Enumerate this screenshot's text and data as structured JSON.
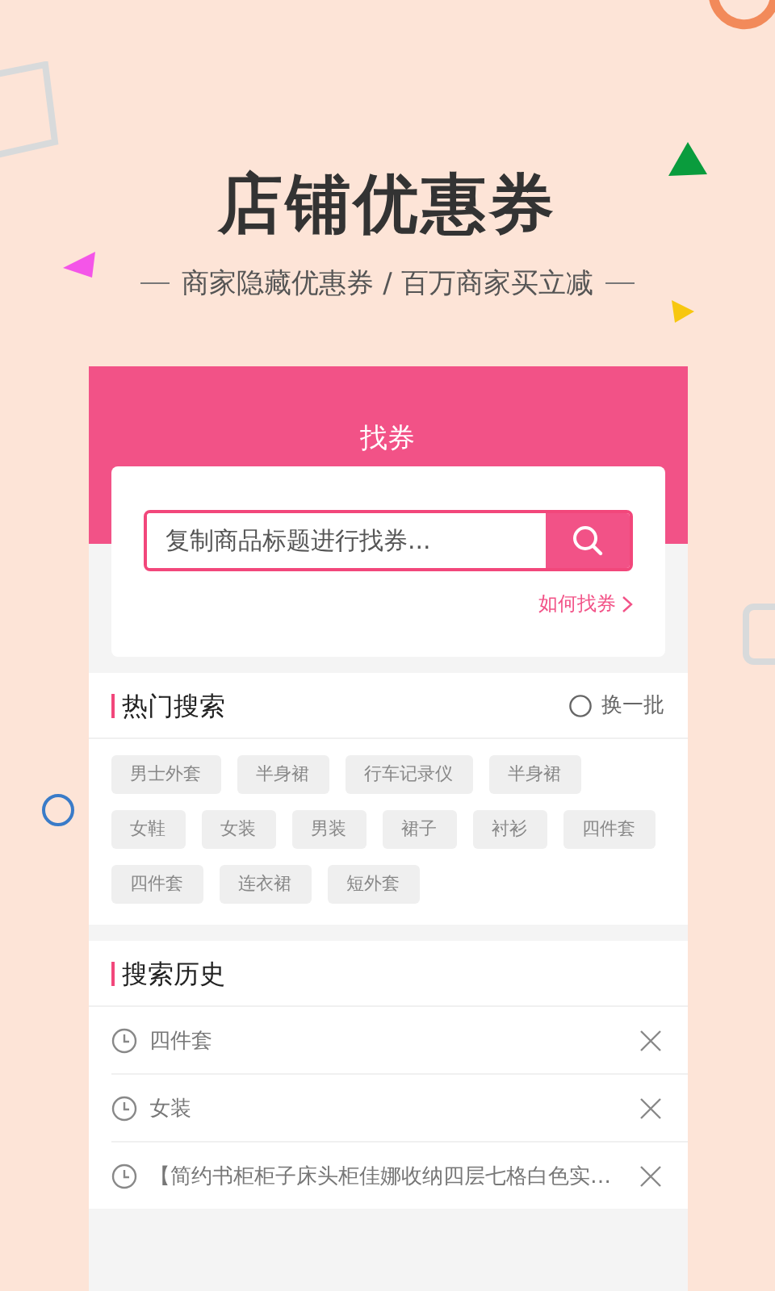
{
  "hero": {
    "title": "店铺优惠券",
    "subtitle": "商家隐藏优惠券 / 百万商家买立减"
  },
  "screen": {
    "title": "找券",
    "search": {
      "placeholder": "复制商品标题进行找券..."
    },
    "help_link": "如何找券",
    "hot_search": {
      "title": "热门搜索",
      "refresh": "换一批",
      "tags": [
        "男士外套",
        "半身裙",
        "行车记录仪",
        "半身裙",
        "女鞋",
        "女装",
        "男装",
        "裙子",
        "衬衫",
        "四件套",
        "四件套",
        "连衣裙",
        "短外套"
      ]
    },
    "history": {
      "title": "搜索历史",
      "items": [
        "四件套",
        "女装",
        "【简约书柜柜子床头柜佳娜收纳四层七格白色实…"
      ]
    }
  }
}
